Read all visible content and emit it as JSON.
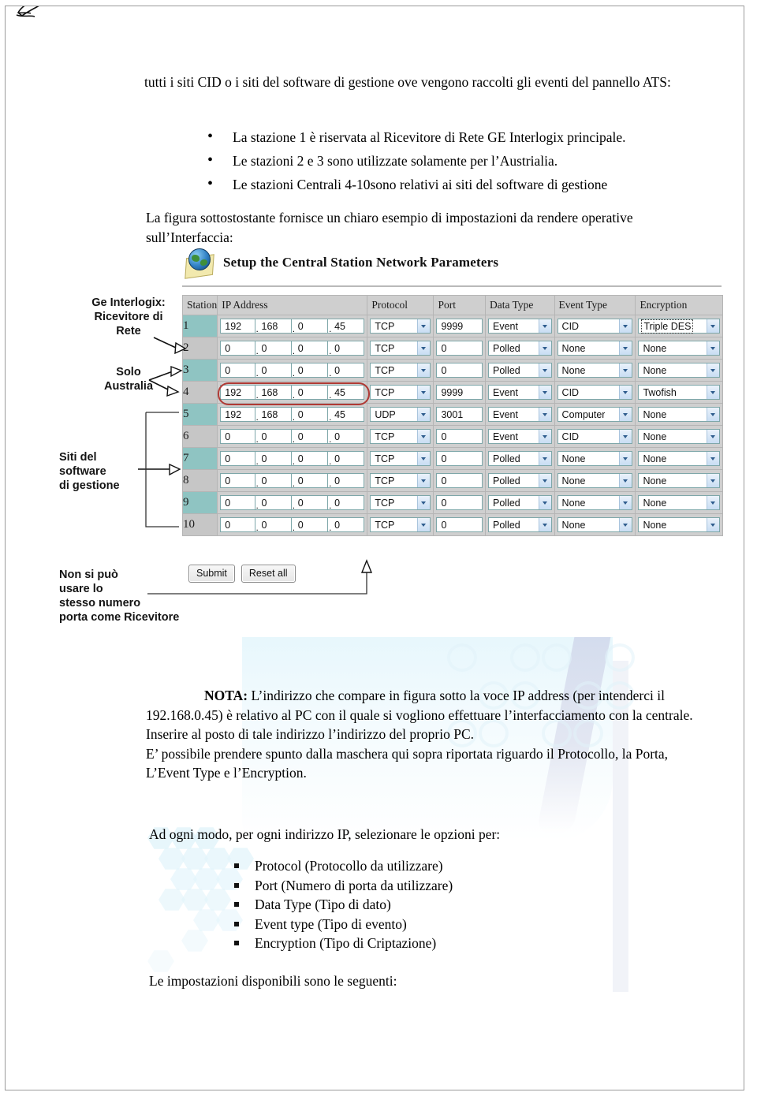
{
  "document": {
    "intro_paragraph": "tutti i siti CID o i siti del software di gestione ove vengono raccolti gli eventi del pannello ATS:",
    "bullets_top": [
      "La stazione 1 è riservata al Ricevitore di Rete GE Interlogix principale.",
      "Le stazioni 2 e 3 sono utilizzate solamente per l’Austrialia.",
      "Le stazioni Centrali 4-10sono relativi ai siti del software di gestione"
    ],
    "figure_intro": "La figura sottostostante fornisce un chiaro esempio di impostazioni da rendere operative sull’Interfaccia:",
    "nota_label": "NOTA:",
    "nota_line1": "L’indirizzo che compare in figura sotto la voce IP address (per intenderci il 192.168.0.45) è relativo al PC con il quale si vogliono effettuare l’interfacciamento con la centrale. Inserire al posto di tale indirizzo l’indirizzo del proprio PC.",
    "nota_line2": "E’ possibile prendere spunto dalla maschera qui sopra riportata riguardo il Protocollo, la Porta, L’Event Type e l’Encryption.",
    "ad_ogni_modo": "Ad ogni modo, per ogni indirizzo IP, selezionare le opzioni per:",
    "bullets_bottom": [
      "Protocol (Protocollo da utilizzare)",
      "Port (Numero di porta da utilizzare)",
      "Data Type (Tipo di dato)",
      "Event type (Tipo di evento)",
      "Encryption (Tipo di Criptazione)"
    ],
    "closing": "Le impostazioni disponibili sono le seguenti:"
  },
  "figure": {
    "annotations": [
      {
        "id": "ge-interlogix",
        "text": "Ge   Interlogix:\nRicevitore   di\nRete"
      },
      {
        "id": "solo-australia",
        "text": "Solo\nAustralia"
      },
      {
        "id": "siti-software",
        "text": "Siti   del\nsoftware\ndi gestione"
      },
      {
        "id": "non-si-puo",
        "text": "Non   si   può\nusare   lo\nstesso   numero\nporta   come   Ricevitore"
      }
    ],
    "app": {
      "title": "Setup the Central Station Network Parameters",
      "icon": "globe-page-icon",
      "columns": [
        "Station",
        "IP Address",
        "Protocol",
        "Port",
        "Data Type",
        "Event Type",
        "Encryption"
      ],
      "buttons": {
        "submit": "Submit",
        "reset": "Reset all"
      },
      "highlighted_row": 4,
      "focused_field": "encryption-row-1",
      "colors": {
        "row_teal": "#8fc4c2",
        "row_gray": "#c6c6c6",
        "header_gray": "#cfcfcf",
        "field_border": "#7ea7a9",
        "highlight_oval": "#b03a35"
      },
      "rows": [
        {
          "station": "1",
          "ip": [
            "192",
            "168",
            "0",
            "45"
          ],
          "protocol": "TCP",
          "port": "9999",
          "data_type": "Event",
          "event_type": "CID",
          "encryption": "Triple DES",
          "shade": "teal"
        },
        {
          "station": "2",
          "ip": [
            "0",
            "0",
            "0",
            "0"
          ],
          "protocol": "TCP",
          "port": "0",
          "data_type": "Polled",
          "event_type": "None",
          "encryption": "None",
          "shade": "gray"
        },
        {
          "station": "3",
          "ip": [
            "0",
            "0",
            "0",
            "0"
          ],
          "protocol": "TCP",
          "port": "0",
          "data_type": "Polled",
          "event_type": "None",
          "encryption": "None",
          "shade": "teal"
        },
        {
          "station": "4",
          "ip": [
            "192",
            "168",
            "0",
            "45"
          ],
          "protocol": "TCP",
          "port": "9999",
          "data_type": "Event",
          "event_type": "CID",
          "encryption": "Twofish",
          "shade": "gray"
        },
        {
          "station": "5",
          "ip": [
            "192",
            "168",
            "0",
            "45"
          ],
          "protocol": "UDP",
          "port": "3001",
          "data_type": "Event",
          "event_type": "Computer",
          "encryption": "None",
          "shade": "teal"
        },
        {
          "station": "6",
          "ip": [
            "0",
            "0",
            "0",
            "0"
          ],
          "protocol": "TCP",
          "port": "0",
          "data_type": "Event",
          "event_type": "CID",
          "encryption": "None",
          "shade": "gray"
        },
        {
          "station": "7",
          "ip": [
            "0",
            "0",
            "0",
            "0"
          ],
          "protocol": "TCP",
          "port": "0",
          "data_type": "Polled",
          "event_type": "None",
          "encryption": "None",
          "shade": "teal"
        },
        {
          "station": "8",
          "ip": [
            "0",
            "0",
            "0",
            "0"
          ],
          "protocol": "TCP",
          "port": "0",
          "data_type": "Polled",
          "event_type": "None",
          "encryption": "None",
          "shade": "gray"
        },
        {
          "station": "9",
          "ip": [
            "0",
            "0",
            "0",
            "0"
          ],
          "protocol": "TCP",
          "port": "0",
          "data_type": "Polled",
          "event_type": "None",
          "encryption": "None",
          "shade": "teal"
        },
        {
          "station": "10",
          "ip": [
            "0",
            "0",
            "0",
            "0"
          ],
          "protocol": "TCP",
          "port": "0",
          "data_type": "Polled",
          "event_type": "None",
          "encryption": "None",
          "shade": "gray"
        }
      ]
    }
  }
}
